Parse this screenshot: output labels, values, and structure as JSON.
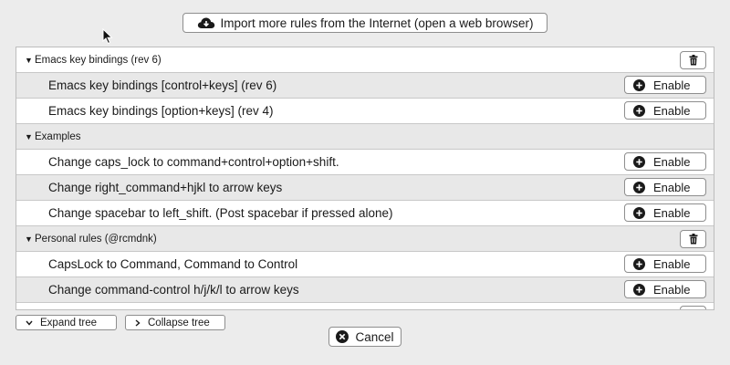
{
  "import_button": {
    "label": "Import more rules from the Internet (open a web browser)",
    "icon": "cloud-download-icon"
  },
  "groups": [
    {
      "title": "Emacs key bindings (rev 6)",
      "items": [
        {
          "label": "Emacs key bindings [control+keys] (rev 6)"
        },
        {
          "label": "Emacs key bindings [option+keys] (rev 4)"
        }
      ]
    },
    {
      "title": "Examples",
      "items": [
        {
          "label": "Change caps_lock to command+control+option+shift."
        },
        {
          "label": "Change right_command+hjkl to arrow keys"
        },
        {
          "label": "Change spacebar to left_shift. (Post spacebar if pressed alone)"
        }
      ]
    },
    {
      "title": "Personal rules (@rcmdnk)",
      "items": [
        {
          "label": "CapsLock to Command, Command to Control"
        },
        {
          "label": "Change command-control h/j/k/l to arrow keys"
        }
      ]
    }
  ],
  "enable_label": "Enable",
  "expand_tree_label": "Expand tree",
  "collapse_tree_label": "Collapse tree",
  "cancel_label": "Cancel",
  "colors": {
    "window_bg": "#ececec",
    "row_shade": "#e8e8e8",
    "row_plain": "#ffffff"
  }
}
